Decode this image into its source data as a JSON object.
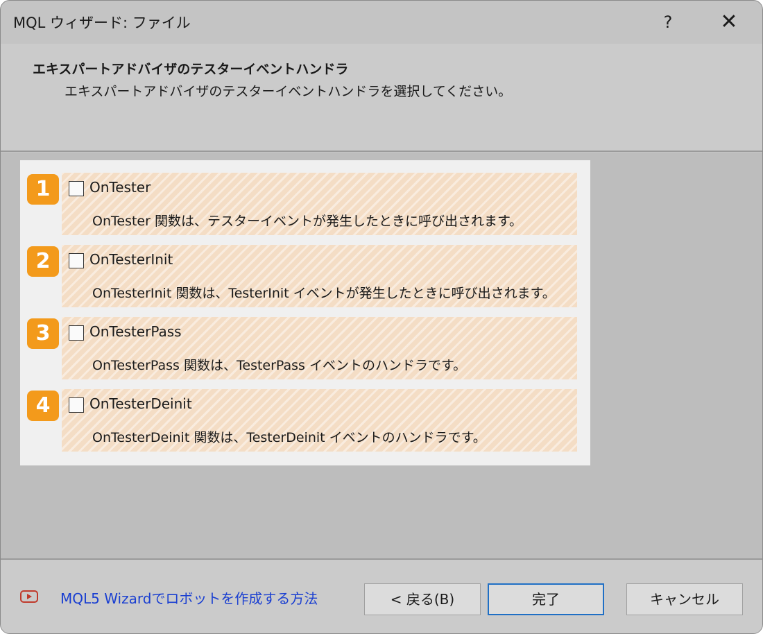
{
  "window": {
    "title": "MQL ウィザード: ファイル",
    "help_label": "?",
    "close_label": "✕"
  },
  "header": {
    "title": "エキスパートアドバイザのテスターイベントハンドラ",
    "subtitle": "エキスパートアドバイザのテスターイベントハンドラを選択してください。"
  },
  "options": [
    {
      "badge": "1",
      "label": "OnTester",
      "checked": false,
      "description": "OnTester 関数は、テスターイベントが発生したときに呼び出されます。"
    },
    {
      "badge": "2",
      "label": "OnTesterInit",
      "checked": false,
      "description": "OnTesterInit 関数は、TesterInit イベントが発生したときに呼び出されます。"
    },
    {
      "badge": "3",
      "label": "OnTesterPass",
      "checked": false,
      "description": "OnTesterPass 関数は、TesterPass イベントのハンドラです。"
    },
    {
      "badge": "4",
      "label": "OnTesterDeinit",
      "checked": false,
      "description": "OnTesterDeinit 関数は、TesterDeinit イベントのハンドラです。"
    }
  ],
  "footer": {
    "help_link": "MQL5 Wizardでロボットを作成する方法",
    "help_icon": "video-play-icon",
    "back_label": "< 戻る(B)",
    "finish_label": "完了",
    "cancel_label": "キャンセル"
  },
  "colors": {
    "badge": "#f39a1b",
    "link": "#1a3fd1",
    "default_button_border": "#1f6fc5"
  }
}
